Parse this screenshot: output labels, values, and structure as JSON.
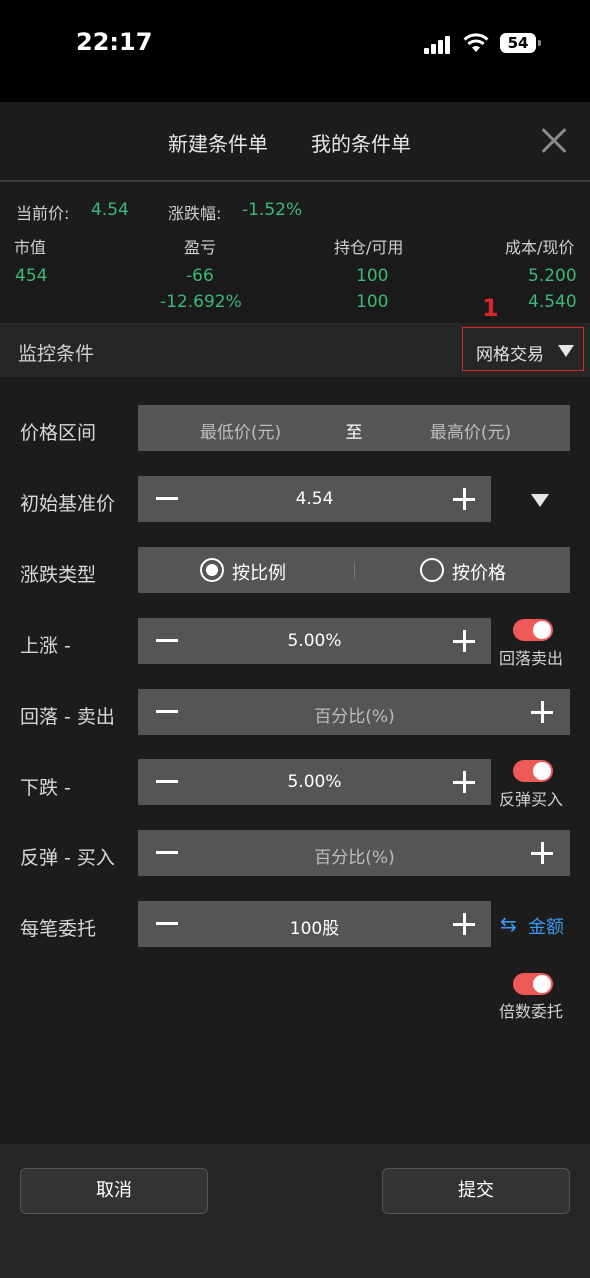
{
  "status": {
    "time": "22:17",
    "battery": "54"
  },
  "tabs": {
    "new_order": "新建条件单",
    "my_orders": "我的条件单"
  },
  "quote": {
    "price_label": "当前价:",
    "price": "4.54",
    "change_label": "涨跌幅:",
    "change": "-1.52%"
  },
  "position": {
    "headers": [
      "市值",
      "盈亏",
      "持仓/可用",
      "成本/现价"
    ],
    "market_value": "454",
    "pnl": "-66",
    "pnl_pct": "-12.692%",
    "holding": "100",
    "available": "100",
    "cost": "5.200",
    "current": "4.540"
  },
  "monitor": {
    "label": "监控条件",
    "selected": "网格交易",
    "badge": "1"
  },
  "form": {
    "price_range": {
      "label": "价格区间",
      "min_placeholder": "最低价(元)",
      "to": "至",
      "max_placeholder": "最高价(元)"
    },
    "base_price": {
      "label": "初始基准价",
      "value": "4.54"
    },
    "change_type": {
      "label": "涨跌类型",
      "option1": "按比例",
      "option2": "按价格"
    },
    "rise": {
      "label": "上涨 -",
      "value": "5.00%",
      "toggle_label": "回落卖出"
    },
    "pullback": {
      "label": "回落 - 卖出",
      "placeholder": "百分比(%)"
    },
    "fall": {
      "label": "下跌 -",
      "value": "5.00%",
      "toggle_label": "反弹买入"
    },
    "rebound": {
      "label": "反弹 - 买入",
      "placeholder": "百分比(%)"
    },
    "per_order": {
      "label": "每笔委托",
      "value": "100股",
      "switch_label": "金额",
      "switch_icon": "swap-arrows-icon"
    },
    "multiple": {
      "toggle_label": "倍数委托"
    }
  },
  "footer": {
    "cancel": "取消",
    "submit": "提交"
  },
  "colors": {
    "green": "#3cb878",
    "toggle_on": "#ee5a57",
    "highlight": "#d52828",
    "link": "#3a9af2"
  }
}
